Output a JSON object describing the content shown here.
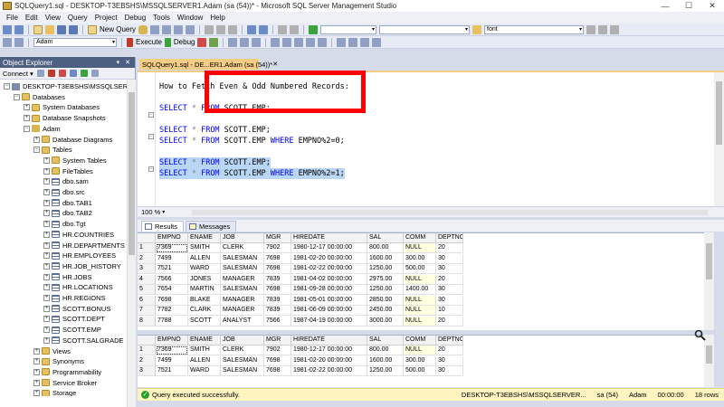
{
  "window": {
    "title": "SQLQuery1.sql - DESKTOP-T3EBSHS\\MSSQLSERVER1.Adam (sa (54))* - Microsoft SQL Server Management Studio",
    "minimize": "—",
    "maximize": "☐",
    "close": "✕"
  },
  "menu": [
    "File",
    "Edit",
    "View",
    "Query",
    "Project",
    "Debug",
    "Tools",
    "Window",
    "Help"
  ],
  "toolbar1": {
    "new_query": "New Query",
    "find_combo": "font"
  },
  "toolbar2": {
    "database": "Adam",
    "execute": "Execute",
    "debug": "Debug"
  },
  "object_explorer": {
    "title": "Object Explorer",
    "pin": "▾ ✕",
    "connect": "Connect ▾",
    "tree": [
      {
        "label": "DESKTOP-T3EBSHS\\MSSQLSERVER1",
        "icon": "server-icon",
        "expander": "−",
        "level": 0
      },
      {
        "label": "Databases",
        "icon": "folder-icon",
        "expander": "−",
        "level": 1
      },
      {
        "label": "System Databases",
        "icon": "folder-icon",
        "expander": "+",
        "level": 2
      },
      {
        "label": "Database Snapshots",
        "icon": "folder-icon",
        "expander": "+",
        "level": 2
      },
      {
        "label": "Adam",
        "icon": "database-icon",
        "expander": "−",
        "level": 2
      },
      {
        "label": "Database Diagrams",
        "icon": "folder-icon",
        "expander": "+",
        "level": 3
      },
      {
        "label": "Tables",
        "icon": "folder-icon",
        "expander": "−",
        "level": 3
      },
      {
        "label": "System Tables",
        "icon": "folder-icon",
        "expander": "+",
        "level": 4
      },
      {
        "label": "FileTables",
        "icon": "folder-icon",
        "expander": "+",
        "level": 4
      },
      {
        "label": "dbo.sam",
        "icon": "table-icon",
        "expander": "+",
        "level": 4
      },
      {
        "label": "dbo.src",
        "icon": "table-icon",
        "expander": "+",
        "level": 4
      },
      {
        "label": "dbo.TAB1",
        "icon": "table-icon",
        "expander": "+",
        "level": 4
      },
      {
        "label": "dbo.TAB2",
        "icon": "table-icon",
        "expander": "+",
        "level": 4
      },
      {
        "label": "dbo.Tgt",
        "icon": "table-icon",
        "expander": "+",
        "level": 4
      },
      {
        "label": "HR.COUNTRIES",
        "icon": "table-icon",
        "expander": "+",
        "level": 4
      },
      {
        "label": "HR.DEPARTMENTS",
        "icon": "table-icon",
        "expander": "+",
        "level": 4
      },
      {
        "label": "HR.EMPLOYEES",
        "icon": "table-icon",
        "expander": "+",
        "level": 4
      },
      {
        "label": "HR.JOB_HISTORY",
        "icon": "table-icon",
        "expander": "+",
        "level": 4
      },
      {
        "label": "HR.JOBS",
        "icon": "table-icon",
        "expander": "+",
        "level": 4
      },
      {
        "label": "HR.LOCATIONS",
        "icon": "table-icon",
        "expander": "+",
        "level": 4
      },
      {
        "label": "HR.REGIONS",
        "icon": "table-icon",
        "expander": "+",
        "level": 4
      },
      {
        "label": "SCOTT.BONUS",
        "icon": "table-icon",
        "expander": "+",
        "level": 4
      },
      {
        "label": "SCOTT.DEPT",
        "icon": "table-icon",
        "expander": "+",
        "level": 4
      },
      {
        "label": "SCOTT.EMP",
        "icon": "table-icon",
        "expander": "+",
        "level": 4
      },
      {
        "label": "SCOTT.SALGRADE",
        "icon": "table-icon",
        "expander": "+",
        "level": 4
      },
      {
        "label": "Views",
        "icon": "folder-icon",
        "expander": "+",
        "level": 3
      },
      {
        "label": "Synonyms",
        "icon": "folder-icon",
        "expander": "+",
        "level": 3
      },
      {
        "label": "Programmability",
        "icon": "folder-icon",
        "expander": "+",
        "level": 3
      },
      {
        "label": "Service Broker",
        "icon": "folder-icon",
        "expander": "+",
        "level": 3
      },
      {
        "label": "Storage",
        "icon": "folder-icon",
        "expander": "+",
        "level": 3
      }
    ]
  },
  "editor": {
    "tab_label": "SQLQuery1.sql - DE...ER1.Adam (sa (54))*",
    "tab_close": "✕",
    "lines": [
      {
        "parts": [
          {
            "t": "How to Fetch Even & Odd Numbered Records:",
            "c": "plain"
          }
        ]
      },
      {
        "parts": [
          {
            "t": "",
            "c": "plain"
          }
        ]
      },
      {
        "parts": [
          {
            "t": "SELECT",
            "c": "kw"
          },
          {
            "t": " * ",
            "c": "gy"
          },
          {
            "t": "FROM",
            "c": "kw"
          },
          {
            "t": " SCOTT.EMP;",
            "c": "plain"
          }
        ]
      },
      {
        "parts": [
          {
            "t": "",
            "c": "plain"
          }
        ]
      },
      {
        "parts": [
          {
            "t": "SELECT",
            "c": "kw"
          },
          {
            "t": " * ",
            "c": "gy"
          },
          {
            "t": "FROM",
            "c": "kw"
          },
          {
            "t": " SCOTT.EMP;",
            "c": "plain"
          }
        ]
      },
      {
        "parts": [
          {
            "t": "SELECT",
            "c": "kw"
          },
          {
            "t": " * ",
            "c": "gy"
          },
          {
            "t": "FROM",
            "c": "kw"
          },
          {
            "t": " SCOTT.EMP ",
            "c": "plain"
          },
          {
            "t": "WHERE",
            "c": "kw"
          },
          {
            "t": " EMPNO%2=0;",
            "c": "plain"
          }
        ]
      },
      {
        "parts": [
          {
            "t": "",
            "c": "plain"
          }
        ]
      },
      {
        "parts": [
          {
            "t": "SELECT",
            "c": "kw"
          },
          {
            "t": " * ",
            "c": "gy"
          },
          {
            "t": "FROM",
            "c": "kw"
          },
          {
            "t": " SCOTT.EMP;",
            "c": "plain"
          }
        ],
        "selected": true
      },
      {
        "parts": [
          {
            "t": "SELECT",
            "c": "kw"
          },
          {
            "t": " * ",
            "c": "gy"
          },
          {
            "t": "FROM",
            "c": "kw"
          },
          {
            "t": " SCOTT.EMP ",
            "c": "plain"
          },
          {
            "t": "WHERE",
            "c": "kw"
          },
          {
            "t": " EMPNO%2=1;",
            "c": "plain"
          }
        ],
        "selected": true
      }
    ],
    "zoom": "100 %"
  },
  "results": {
    "tabs": [
      "Results",
      "Messages"
    ],
    "columns": [
      "",
      "EMPNO",
      "ENAME",
      "JOB",
      "MGR",
      "HIREDATE",
      "SAL",
      "COMM",
      "DEPTNO"
    ],
    "grid1_rows": [
      [
        "1",
        "7369",
        "SMITH",
        "CLERK",
        "7902",
        "1980-12-17 00:00:00",
        "800.00",
        "NULL",
        "20"
      ],
      [
        "2",
        "7499",
        "ALLEN",
        "SALESMAN",
        "7698",
        "1981-02-20 00:00:00",
        "1600.00",
        "300.00",
        "30"
      ],
      [
        "3",
        "7521",
        "WARD",
        "SALESMAN",
        "7698",
        "1981-02-22 00:00:00",
        "1250.00",
        "500.00",
        "30"
      ],
      [
        "4",
        "7566",
        "JONES",
        "MANAGER",
        "7839",
        "1981-04-02 00:00:00",
        "2975.00",
        "NULL",
        "20"
      ],
      [
        "5",
        "7654",
        "MARTIN",
        "SALESMAN",
        "7698",
        "1981-09-28 00:00:00",
        "1250.00",
        "1400.00",
        "30"
      ],
      [
        "6",
        "7698",
        "BLAKE",
        "MANAGER",
        "7839",
        "1981-05-01 00:00:00",
        "2850.00",
        "NULL",
        "30"
      ],
      [
        "7",
        "7782",
        "CLARK",
        "MANAGER",
        "7839",
        "1981-06-09 00:00:00",
        "2450.00",
        "NULL",
        "10"
      ],
      [
        "8",
        "7788",
        "SCOTT",
        "ANALYST",
        "7566",
        "1987-04-19 00:00:00",
        "3000.00",
        "NULL",
        "20"
      ]
    ],
    "grid2_rows": [
      [
        "1",
        "7369",
        "SMITH",
        "CLERK",
        "7902",
        "1980-12-17 00:00:00",
        "800.00",
        "NULL",
        "20"
      ],
      [
        "2",
        "7499",
        "ALLEN",
        "SALESMAN",
        "7698",
        "1981-02-20 00:00:00",
        "1600.00",
        "300.00",
        "30"
      ],
      [
        "3",
        "7521",
        "WARD",
        "SALESMAN",
        "7698",
        "1981-02-22 00:00:00",
        "1250.00",
        "500.00",
        "30"
      ]
    ]
  },
  "status": {
    "message": "Query executed successfully.",
    "server": "DESKTOP-T3EBSHS\\MSSQLSERVER...",
    "user": "sa (54)",
    "database": "Adam",
    "time": "00:00:00",
    "rows": "18 rows"
  },
  "colors": {
    "accent_tab": "#f5cc84",
    "callout_border": "#ff0000",
    "keyword": "#0000ff",
    "status_bar": "#fdf4bf"
  }
}
